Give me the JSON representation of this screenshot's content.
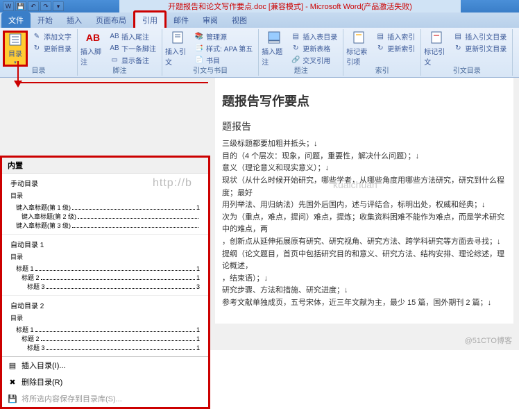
{
  "titlebar": {
    "title": "开题报告和论文写作要点.doc [兼容模式] - Microsoft Word(产品激活失败)"
  },
  "tabs": {
    "file": "文件",
    "home": "开始",
    "insert": "插入",
    "layout": "页面布局",
    "references": "引用",
    "mailings": "邮件",
    "review": "审阅",
    "view": "视图"
  },
  "ribbon": {
    "toc": {
      "label": "目录",
      "add_text": "添加文字",
      "update": "更新目录",
      "group": "目录"
    },
    "footnotes": {
      "insert": "插入脚注",
      "endnote": "插入尾注",
      "next": "下一条脚注",
      "show": "显示备注",
      "group": "脚注",
      "ab": "AB"
    },
    "citations": {
      "insert": "插入引文",
      "manage": "管理源",
      "style_lbl": "样式:",
      "style_val": "APA 第五",
      "biblio": "书目",
      "group": "引文与书目"
    },
    "captions": {
      "insert": "插入题注",
      "fig_toc": "插入表目录",
      "update": "更新表格",
      "xref": "交叉引用",
      "group": "题注"
    },
    "index": {
      "mark": "标记索引项",
      "insert": "插入索引",
      "update": "更新索引",
      "group": "索引"
    },
    "authorities": {
      "mark": "标记引文",
      "insert": "插入引文目录",
      "update": "更新引文目录",
      "group": "引文目录"
    }
  },
  "dropdown": {
    "builtin": "内置",
    "manual": "手动目录",
    "toc_label": "目录",
    "chapter1": "键入章标题(第 1 级)",
    "chapter2": "键入章标题(第 2 级)",
    "chapter3": "键入章标题(第 3 级)",
    "auto1": "自动目录 1",
    "auto2": "自动目录 2",
    "h1": "标题 1",
    "h2": "标题 2",
    "h3": "标题 3",
    "p1": "1",
    "p3": "3",
    "insert_toc": "插入目录(I)...",
    "remove_toc": "删除目录(R)",
    "save_sel": "将所选内容保存到目录库(S)..."
  },
  "document": {
    "title": "题报告写作要点",
    "section": "题报告",
    "l1": "三级标题都要加粗并抵头；↓",
    "l2": "目的（4 个层次：现象，问题，重要性，解决什么问题）；↓",
    "l3": "意义（理论意义和现实意义）；↓",
    "l4": "现状（从什么时候开始研究，哪些学者，从哪些角度用哪些方法研究，研究到什么程度；最好",
    "l5": "用列举法、用归纳法）先国外后国内，述与评结合，标明出处，权威和经典；↓",
    "l6": "次为（重点，难点，提问）难点，提炼；收集资料困难不能作为难点，而是学术研究中的难点，两",
    "l7": "，创新点从延伸拓展原有研究、研究视角、研究方法、跨学科研究等方面去寻找；↓",
    "l8": "提纲（论文题目，首页中包括研究目的和意义、研究方法、结构安排、理论综述，理论概述，",
    "l9": "，结束语）；↓",
    "l10": "研究步骤、方法和措施、研究进度；↓",
    "l11": "参考文献单独成页，五号宋体，近三年文献为主，最少 15 篇，国外期刊 2 篇；↓"
  },
  "watermark": "http://b",
  "watermark_right": "kuaichuan",
  "blog": "@51CTO博客"
}
